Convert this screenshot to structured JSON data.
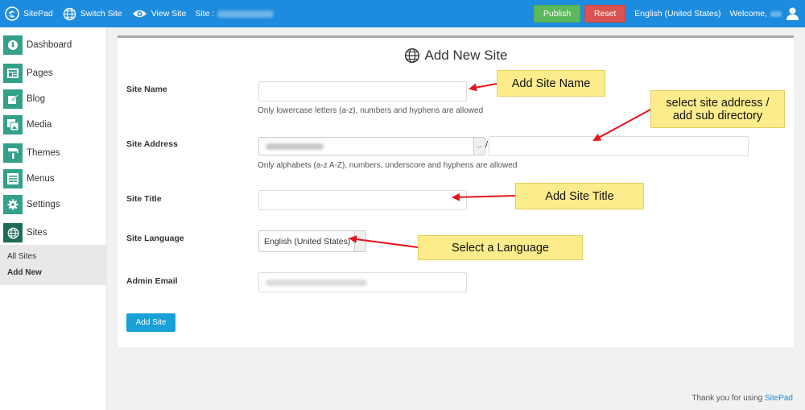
{
  "topbar": {
    "brand": "SitePad",
    "switch_site": "Switch Site",
    "view_site": "View Site",
    "site_label": "Site :",
    "publish": "Publish",
    "reset": "Reset",
    "language": "English (United States)",
    "welcome": "Welcome,"
  },
  "sidebar": {
    "items": [
      {
        "label": "Dashboard",
        "icon": "dashboard-icon"
      },
      {
        "label": "Pages",
        "icon": "pages-icon"
      },
      {
        "label": "Blog",
        "icon": "blog-icon"
      },
      {
        "label": "Media",
        "icon": "media-icon"
      },
      {
        "label": "Themes",
        "icon": "themes-icon"
      },
      {
        "label": "Menus",
        "icon": "menus-icon"
      },
      {
        "label": "Settings",
        "icon": "gear-icon"
      },
      {
        "label": "Sites",
        "icon": "globe-icon"
      }
    ],
    "submenu": [
      "All Sites",
      "Add New"
    ]
  },
  "form": {
    "title": "Add New Site",
    "site_name_label": "Site Name",
    "site_name_help": "Only lowercase letters (a-z), numbers and hyphens are allowed",
    "site_address_label": "Site Address",
    "site_address_sep": "/",
    "site_address_help": "Only alphabets (a-z A-Z), numbers, underscore and hyphens are allowed",
    "site_title_label": "Site Title",
    "site_language_label": "Site Language",
    "site_language_value": "English (United States)",
    "admin_email_label": "Admin Email",
    "submit": "Add Site"
  },
  "callouts": {
    "site_name": "Add Site Name",
    "site_address_line1": "select site address /",
    "site_address_line2": "add sub directory",
    "site_title": "Add Site Title",
    "language": "Select a Language"
  },
  "footer": {
    "text": "Thank you for using ",
    "link": "SitePad"
  },
  "colors": {
    "topbar": "#1e8cde",
    "sidebar_icon": "#33a08a",
    "publish": "#5cb85c",
    "reset": "#d9534f",
    "add_button": "#19a0d8",
    "callout": "#fdec8c",
    "arrow": "#e8141c"
  }
}
